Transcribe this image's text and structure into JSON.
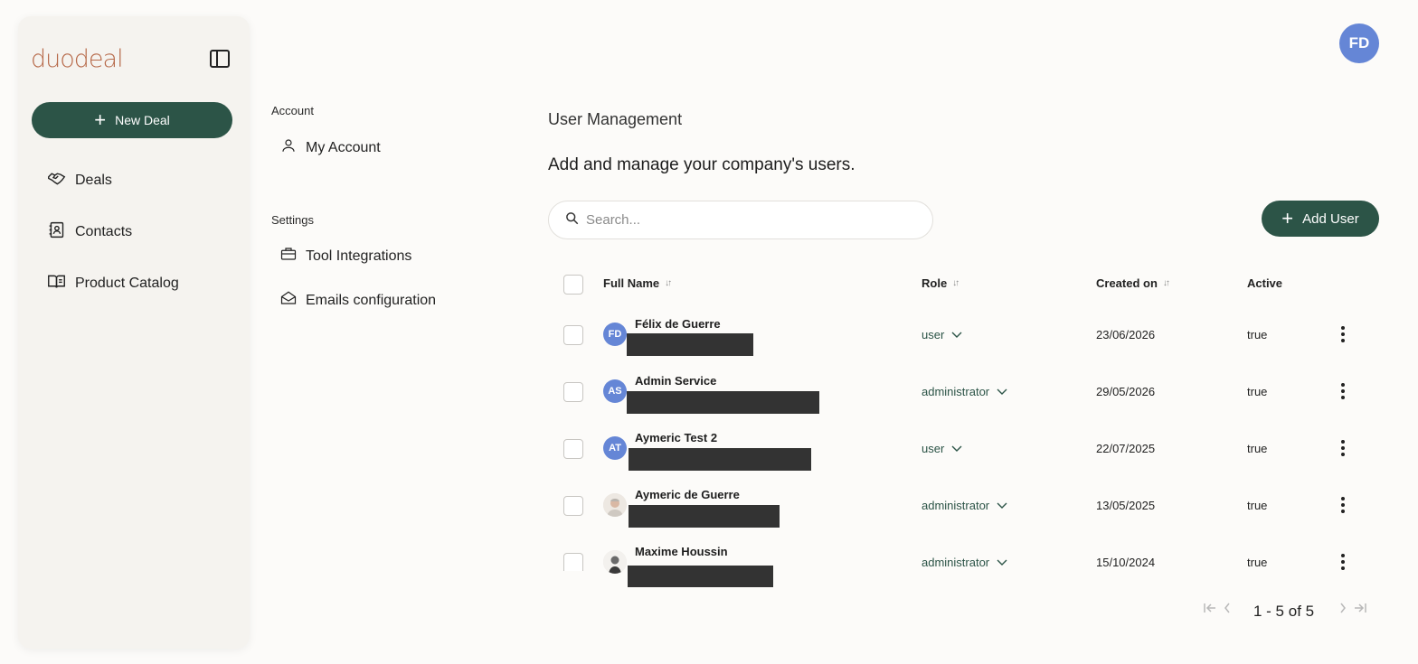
{
  "sidebar": {
    "logo": "duodeal",
    "new_deal_label": "New Deal",
    "items": [
      {
        "label": "Deals",
        "icon": "handshake-icon"
      },
      {
        "label": "Contacts",
        "icon": "contacts-icon"
      },
      {
        "label": "Product Catalog",
        "icon": "book-icon"
      }
    ]
  },
  "settings_nav": {
    "account_section": "Account",
    "account_items": [
      {
        "label": "My Account",
        "icon": "user-icon"
      }
    ],
    "settings_section": "Settings",
    "settings_items": [
      {
        "label": "Tool Integrations",
        "icon": "briefcase-icon"
      },
      {
        "label": "Emails configuration",
        "icon": "envelope-icon"
      }
    ]
  },
  "header": {
    "user_initials": "FD"
  },
  "main": {
    "title": "User Management",
    "subtitle": "Add and manage your company's users.",
    "search_placeholder": "Search...",
    "add_user_label": "Add User",
    "columns": {
      "full_name": "Full Name",
      "role": "Role",
      "created_on": "Created on",
      "active": "Active"
    },
    "rows": [
      {
        "initials": "FD",
        "name": "Félix de Guerre",
        "role": "user",
        "created": "23/06/2026",
        "active": "true"
      },
      {
        "initials": "AS",
        "name": "Admin Service",
        "role": "administrator",
        "created": "29/05/2026",
        "active": "true"
      },
      {
        "initials": "AT",
        "name": "Aymeric Test 2",
        "role": "user",
        "created": "22/07/2025",
        "active": "true"
      },
      {
        "initials": "",
        "name": "Aymeric de Guerre",
        "role": "administrator",
        "created": "13/05/2025",
        "active": "true"
      },
      {
        "initials": "",
        "name": "Maxime Houssin",
        "role": "administrator",
        "created": "15/10/2024",
        "active": "true"
      }
    ],
    "pagination": "1 - 5 of 5"
  },
  "colors": {
    "brand_green": "#2c5447",
    "avatar_blue": "#6586d6",
    "logo_copper": "#b76a4a"
  }
}
